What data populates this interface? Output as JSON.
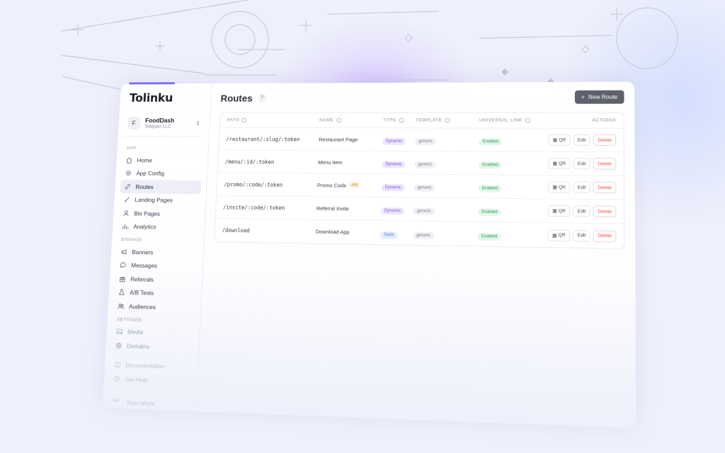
{
  "brand": {
    "name": "Tolinku",
    "accent": "#7b6cf0"
  },
  "workspace": {
    "initial": "F",
    "name": "FoodDash",
    "org": "Sitepact LLC"
  },
  "sidebar": {
    "sections": [
      {
        "label": "APP",
        "items": [
          {
            "label": "Home",
            "icon": "home-icon"
          },
          {
            "label": "App Config",
            "icon": "gear-icon"
          },
          {
            "label": "Routes",
            "icon": "link-icon",
            "active": true
          },
          {
            "label": "Landing Pages",
            "icon": "brush-icon"
          },
          {
            "label": "Bio Pages",
            "icon": "user-icon"
          },
          {
            "label": "Analytics",
            "icon": "bar-chart-icon"
          }
        ]
      },
      {
        "label": "ENGAGE",
        "items": [
          {
            "label": "Banners",
            "icon": "megaphone-icon"
          },
          {
            "label": "Messages",
            "icon": "chat-icon"
          },
          {
            "label": "Referrals",
            "icon": "gift-icon"
          },
          {
            "label": "A/B Tests",
            "icon": "flask-icon"
          },
          {
            "label": "Audiences",
            "icon": "users-icon"
          }
        ]
      },
      {
        "label": "SETTINGS",
        "items": [
          {
            "label": "Media",
            "icon": "image-icon"
          },
          {
            "label": "Domains",
            "icon": "globe-icon"
          }
        ]
      }
    ],
    "footer_links": [
      {
        "label": "Documentation",
        "icon": "book-icon"
      },
      {
        "label": "Get Help",
        "icon": "help-icon"
      }
    ],
    "user": {
      "initials": "RW",
      "name": "Ryan Whyte"
    }
  },
  "main": {
    "title": "Routes",
    "help": "?",
    "new_button": "New Route",
    "columns": [
      "PATH",
      "NAME",
      "TYPE",
      "TEMPLATE",
      "UNIVERSAL LINK",
      "ACTIONS"
    ],
    "rows": [
      {
        "path": "/restaurant/:slug/:token",
        "name": "Restaurant Page",
        "badge": "",
        "type": "Dynamic",
        "template": "generic",
        "universal_link": "Enabled"
      },
      {
        "path": "/menu/:id/:token",
        "name": "Menu Item",
        "badge": "",
        "type": "Dynamic",
        "template": "generic",
        "universal_link": "Enabled"
      },
      {
        "path": "/promo/:code/:token",
        "name": "Promo Code",
        "badge": "A/B",
        "type": "Dynamic",
        "template": "generic",
        "universal_link": "Enabled"
      },
      {
        "path": "/invite/:code/:token",
        "name": "Referral Invite",
        "badge": "",
        "type": "Dynamic",
        "template": "generic",
        "universal_link": "Enabled"
      },
      {
        "path": "/download",
        "name": "Download App",
        "badge": "",
        "type": "Static",
        "template": "generic",
        "universal_link": "Enabled"
      }
    ],
    "actions": {
      "qr": "QR",
      "edit": "Edit",
      "delete": "Delete"
    }
  }
}
